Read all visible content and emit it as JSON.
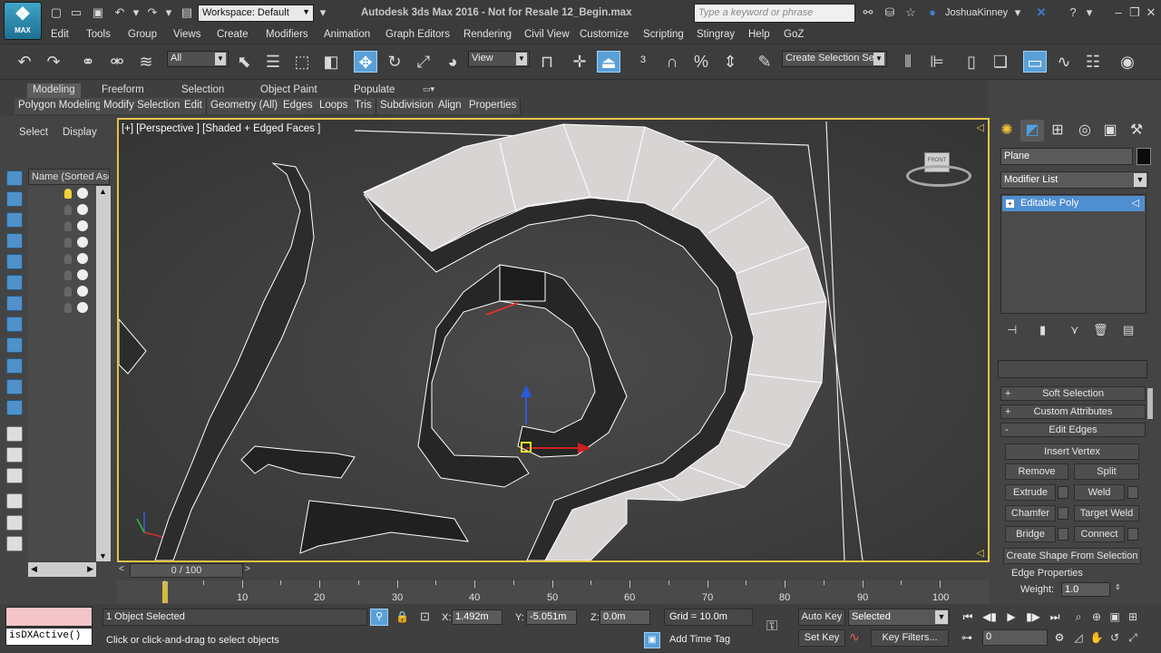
{
  "app": {
    "title": "Autodesk 3ds Max 2016 - Not for Resale   12_Begin.max",
    "logo_label": "MAX",
    "workspace": "Workspace: Default",
    "search_placeholder": "Type a keyword or phrase",
    "user": "JoshuaKinney"
  },
  "menu": [
    "Edit",
    "Tools",
    "Group",
    "Views",
    "Create",
    "Modifiers",
    "Animation",
    "Graph Editors",
    "Rendering",
    "Civil View",
    "Customize",
    "Scripting",
    "Stingray",
    "Help",
    "GoZ"
  ],
  "toolbar": {
    "selection_filter": "All",
    "ref_coord": "View",
    "named_selection": "Create Selection Se"
  },
  "ribbon": {
    "tabs": [
      "Modeling",
      "Freeform",
      "Selection",
      "Object Paint",
      "Populate"
    ],
    "active_tab": "Modeling",
    "subtabs": [
      "Polygon Modeling",
      "Modify Selection",
      "Edit",
      "Geometry (All)",
      "Edges",
      "Loops",
      "Tris",
      "Subdivision",
      "Align",
      "Properties"
    ]
  },
  "explorer": {
    "tabs": [
      "Select",
      "Display"
    ],
    "column_header": "Name (Sorted Asce"
  },
  "viewport": {
    "label": "[+] [Perspective ] [Shaded + Edged Faces ]",
    "viewcube_label": "FRONT"
  },
  "command_panel": {
    "object_name": "Plane",
    "object_color": "#0c0c0c",
    "modifier_list": "Modifier List",
    "stack_item": "Editable Poly",
    "rollouts": [
      {
        "sign": "+",
        "label": "Soft Selection"
      },
      {
        "sign": "+",
        "label": "Custom Attributes"
      },
      {
        "sign": "-",
        "label": "Edit Edges"
      }
    ],
    "buttons": {
      "insert_vertex": "Insert Vertex",
      "remove": "Remove",
      "split": "Split",
      "extrude": "Extrude",
      "weld": "Weld",
      "chamfer": "Chamfer",
      "target_weld": "Target Weld",
      "bridge": "Bridge",
      "connect": "Connect",
      "create_shape": "Create Shape From Selection"
    },
    "edge_properties": "Edge Properties",
    "weight_label": "Weight:",
    "weight_value": "1.0"
  },
  "timeline": {
    "position": "0 / 100",
    "ticks": [
      "10",
      "20",
      "30",
      "40",
      "50",
      "60",
      "70",
      "80",
      "90",
      "100"
    ]
  },
  "status": {
    "maxscript_value": "isDXActive()",
    "selection_count": "1 Object Selected",
    "prompt": "Click or click-and-drag to select objects",
    "x_label": "X:",
    "x": "1.492m",
    "y_label": "Y:",
    "y": "-5.051m",
    "z_label": "Z:",
    "z": "0.0m",
    "grid": "Grid = 10.0m",
    "add_time_tag": "Add Time Tag",
    "auto_key": "Auto Key",
    "set_key": "Set Key",
    "key_mode": "Selected",
    "key_filters": "Key Filters...",
    "frame": "0"
  },
  "colors": {
    "accent": "#5aa0d8",
    "viewport_border": "#e3c24a",
    "selected_item": "#4f8ecf"
  }
}
